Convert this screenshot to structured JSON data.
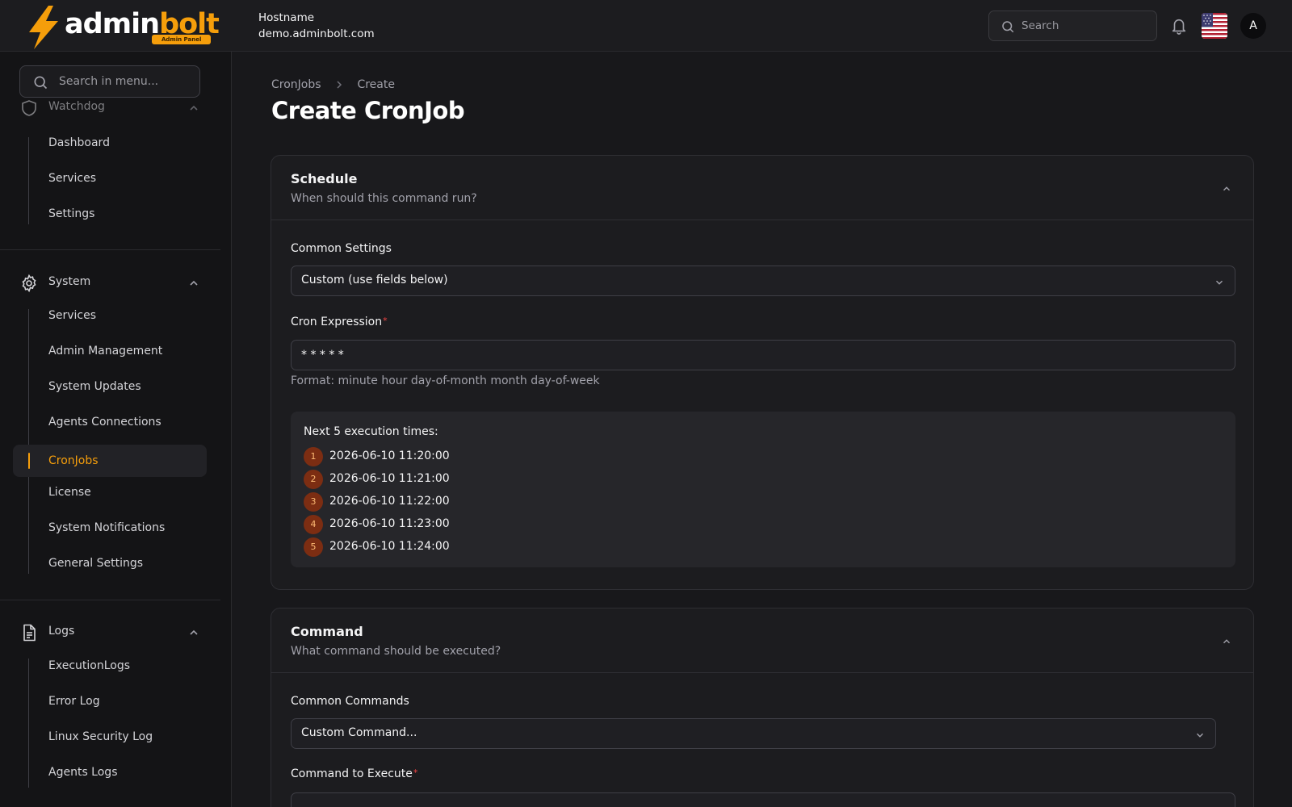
{
  "app": {
    "logo_main": "admin",
    "logo_accent": "bolt",
    "logo_badge": "Admin Panel",
    "hostname_label": "Hostname",
    "hostname_value": "demo.adminbolt.com",
    "search_placeholder": "Search",
    "avatar_initial": "A",
    "accent_color": "#f59e0b"
  },
  "sidebar": {
    "search_placeholder": "Search in menu...",
    "groups": [
      {
        "label": "Watchdog",
        "icon": "shield-icon",
        "items": [
          "Dashboard",
          "Services",
          "Settings"
        ]
      },
      {
        "label": "System",
        "icon": "gear-icon",
        "items": [
          "Services",
          "Admin Management",
          "System Updates",
          "Agents Connections",
          "CronJobs",
          "License",
          "System Notifications",
          "General Settings"
        ],
        "active": "CronJobs"
      },
      {
        "label": "Logs",
        "icon": "document-icon",
        "items": [
          "ExecutionLogs",
          "Error Log",
          "Linux Security Log",
          "Agents Logs"
        ]
      }
    ]
  },
  "breadcrumb": [
    "CronJobs",
    "Create"
  ],
  "page_title": "Create CronJob",
  "schedule": {
    "title": "Schedule",
    "subtitle": "When should this command run?",
    "common_settings_label": "Common Settings",
    "common_settings_value": "Custom (use fields below)",
    "cron_label": "Cron Expression",
    "required_mark": "*",
    "cron_value": "* * * * *",
    "cron_hint": "Format: minute hour day-of-month month day-of-week",
    "next_title": "Next 5 execution times:",
    "next_times": [
      {
        "n": "1",
        "time": "2026-06-10 11:20:00"
      },
      {
        "n": "2",
        "time": "2026-06-10 11:21:00"
      },
      {
        "n": "3",
        "time": "2026-06-10 11:22:00"
      },
      {
        "n": "4",
        "time": "2026-06-10 11:23:00"
      },
      {
        "n": "5",
        "time": "2026-06-10 11:24:00"
      }
    ]
  },
  "command": {
    "title": "Command",
    "subtitle": "What command should be executed?",
    "common_commands_label": "Common Commands",
    "common_commands_value": "Custom Command...",
    "execute_label": "Command to Execute",
    "required_mark": "*"
  }
}
